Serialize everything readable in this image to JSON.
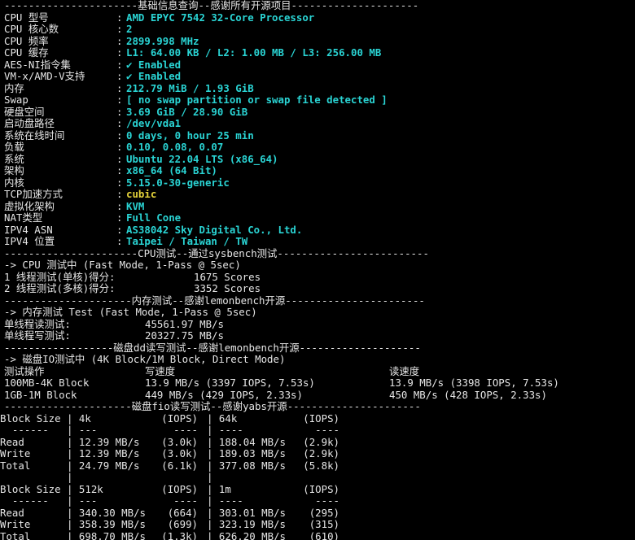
{
  "basic": {
    "header": "----------------------基础信息查询--感谢所有开源项目---------------------",
    "rows": [
      {
        "label": "CPU 型号",
        "value": "AMD EPYC 7542 32-Core Processor",
        "color": "cyan"
      },
      {
        "label": "CPU 核心数",
        "value": "2",
        "color": "cyan"
      },
      {
        "label": "CPU 频率",
        "value": "2899.998 MHz",
        "color": "cyan"
      },
      {
        "label": "CPU 缓存",
        "value": "L1: 64.00 KB / L2: 1.00 MB / L3: 256.00 MB",
        "color": "cyan"
      },
      {
        "label": "AES-NI指令集",
        "value": "✔ Enabled",
        "color": "cyan"
      },
      {
        "label": "VM-x/AMD-V支持",
        "value": "✔ Enabled",
        "color": "cyan"
      },
      {
        "label": "内存",
        "value": "212.79 MiB / 1.93 GiB",
        "color": "cyan"
      },
      {
        "label": "Swap",
        "value": "[ no swap partition or swap file detected ]",
        "color": "cyan"
      },
      {
        "label": "硬盘空间",
        "value": "3.69 GiB / 28.90 GiB",
        "color": "cyan"
      },
      {
        "label": "启动盘路径",
        "value": "/dev/vda1",
        "color": "cyan"
      },
      {
        "label": "系统在线时间",
        "value": "0 days, 0 hour 25 min",
        "color": "cyan"
      },
      {
        "label": "负载",
        "value": "0.10, 0.08, 0.07",
        "color": "cyan"
      },
      {
        "label": "系统",
        "value": "Ubuntu 22.04 LTS (x86_64)",
        "color": "cyan"
      },
      {
        "label": "架构",
        "value": "x86_64 (64 Bit)",
        "color": "cyan"
      },
      {
        "label": "内核",
        "value": "5.15.0-30-generic",
        "color": "cyan"
      },
      {
        "label": "TCP加速方式",
        "value": "cubic",
        "color": "yellow"
      },
      {
        "label": "虚拟化架构",
        "value": "KVM",
        "color": "cyan"
      },
      {
        "label": "NAT类型",
        "value": "Full Cone",
        "color": "cyan"
      },
      {
        "label": "IPV4 ASN",
        "value": "AS38042 Sky Digital Co., Ltd.",
        "color": "cyan"
      },
      {
        "label": "IPV4 位置",
        "value": "Taipei / Taiwan / TW",
        "color": "cyan"
      }
    ],
    "separator": ":"
  },
  "cpu": {
    "header": "----------------------CPU测试--通过sysbench测试-------------------------",
    "mode": "-> CPU 测试中 (Fast Mode, 1-Pass @ 5sec)",
    "rows": [
      {
        "label": "1 线程测试(单核)得分:",
        "value": "1675 Scores"
      },
      {
        "label": "2 线程测试(多核)得分:",
        "value": "3352 Scores"
      }
    ]
  },
  "memory": {
    "header": "---------------------内存测试--感谢lemonbench开源-----------------------",
    "mode": "-> 内存测试 Test (Fast Mode, 1-Pass @ 5sec)",
    "rows": [
      {
        "label": "单线程读测试:",
        "value": "45561.97 MB/s"
      },
      {
        "label": "单线程写测试:",
        "value": "20327.75 MB/s"
      }
    ]
  },
  "disk_dd": {
    "header": "------------------磁盘dd读写测试--感谢lemonbench开源--------------------",
    "mode": "-> 磁盘IO测试中 (4K Block/1M Block, Direct Mode)",
    "columns": [
      "测试操作",
      "写速度",
      "读速度"
    ],
    "rows": [
      {
        "op": "100MB-4K Block",
        "write": "13.9 MB/s (3397 IOPS, 7.53s)",
        "read": "13.9 MB/s (3398 IOPS, 7.53s)"
      },
      {
        "op": "1GB-1M Block",
        "write": "449 MB/s (429 IOPS, 2.33s)",
        "read": "450 MB/s (428 IOPS, 2.33s)"
      }
    ]
  },
  "disk_fio": {
    "header": "---------------------磁盘fio读写测试--感谢yabs开源----------------------",
    "lines": [
      [
        "Block Size",
        "| 4k",
        "(IOPS)",
        "| 64k",
        "(IOPS)"
      ],
      [
        "  ------",
        "| ---",
        "----",
        "| ----",
        "----"
      ],
      [
        "Read",
        "| 12.39 MB/s",
        "(3.0k)",
        "| 188.04 MB/s",
        "(2.9k)"
      ],
      [
        "Write",
        "| 12.39 MB/s",
        "(3.0k)",
        "| 189.03 MB/s",
        "(2.9k)"
      ],
      [
        "Total",
        "| 24.79 MB/s",
        "(6.1k)",
        "| 377.08 MB/s",
        "(5.8k)"
      ],
      [
        "",
        "|",
        "",
        "|",
        ""
      ],
      [
        "Block Size",
        "| 512k",
        "(IOPS)",
        "| 1m",
        "(IOPS)"
      ],
      [
        "  ------",
        "| ---",
        "----",
        "| ----",
        "----"
      ],
      [
        "Read",
        "| 340.30 MB/s",
        "(664)",
        "| 303.01 MB/s",
        "(295)"
      ],
      [
        "Write",
        "| 358.39 MB/s",
        "(699)",
        "| 323.19 MB/s",
        "(315)"
      ],
      [
        "Total",
        "| 698.70 MB/s",
        "(1.3k)",
        "| 626.20 MB/s",
        "(610)"
      ]
    ]
  }
}
